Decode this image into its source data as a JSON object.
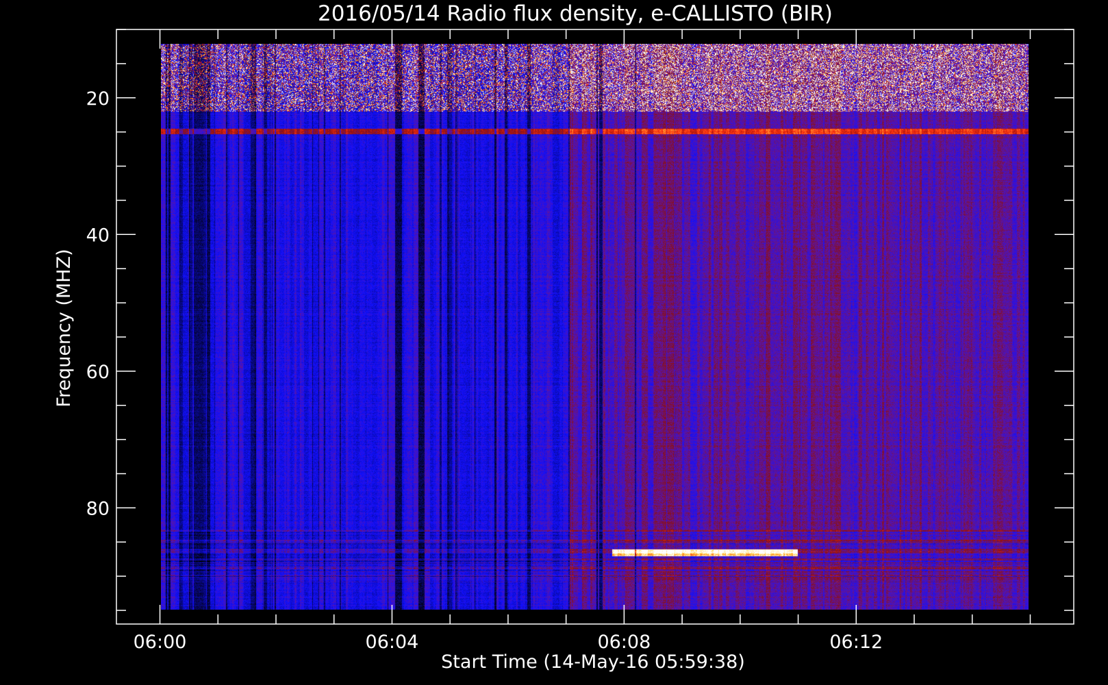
{
  "chart_data": {
    "type": "heatmap",
    "title": "2016/05/14  Radio flux density, e-CALLISTO (BIR)",
    "xlabel": "Start Time (14-May-16 05:59:38)",
    "ylabel": "Frequency (MHZ)",
    "x_ticks": [
      "06:00",
      "06:04",
      "06:08",
      "06:12"
    ],
    "x_tick_minutes": [
      0,
      4,
      8,
      12
    ],
    "x_minor_step_minutes": 1,
    "x_range_minutes": [
      -0.75,
      15.75
    ],
    "data_x_range_minutes": [
      0.0,
      15.0
    ],
    "y_ticks": [
      "20",
      "40",
      "60",
      "80"
    ],
    "y_tick_values": [
      20,
      40,
      60,
      80
    ],
    "y_minor_step": 5,
    "y_range": [
      10,
      97
    ],
    "data_y_range": [
      12,
      96
    ],
    "y_inverted": true,
    "grid": false,
    "colormap": [
      "#000000",
      "#1010ff",
      "#5a14a8",
      "#8c1010",
      "#ff3010",
      "#ffd040",
      "#ffffff"
    ],
    "features": [
      {
        "label": "bursty emission",
        "freq_range": [
          12,
          22
        ],
        "intensity": 0.8
      },
      {
        "label": "transmitter line",
        "freq": 25,
        "intensity": 0.55
      },
      {
        "label": "interference band",
        "freq_range": [
          84,
          92
        ],
        "intensity": 0.6
      },
      {
        "label": "bright band",
        "freq": 87.5,
        "time_range": [
          7.8,
          11.0
        ],
        "intensity": 0.85
      }
    ]
  }
}
